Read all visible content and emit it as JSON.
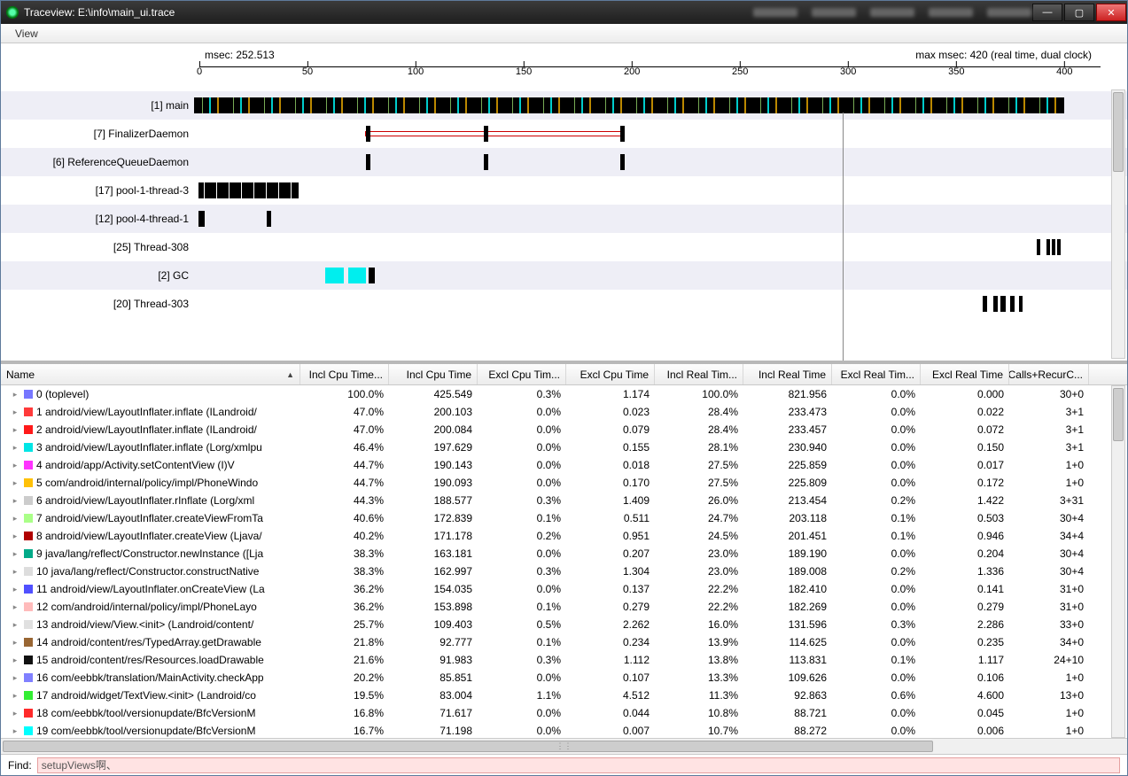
{
  "window": {
    "title": "Traceview: E:\\info\\main_ui.trace",
    "menu_view": "View"
  },
  "timeline": {
    "msec_label": "msec: 252.513",
    "max_label": "max msec: 420 (real time, dual clock)",
    "ticks": [
      "0",
      "50",
      "100",
      "150",
      "200",
      "250",
      "300",
      "350",
      "400"
    ],
    "cursor_pos_pct": 60.0,
    "rows": [
      {
        "label": "[1] main"
      },
      {
        "label": "[7] FinalizerDaemon"
      },
      {
        "label": "[6] ReferenceQueueDaemon"
      },
      {
        "label": "[17] pool-1-thread-3"
      },
      {
        "label": "[12] pool-4-thread-1"
      },
      {
        "label": "[25] Thread-308"
      },
      {
        "label": "[2] GC"
      },
      {
        "label": "[20] Thread-303"
      }
    ]
  },
  "table": {
    "headers": {
      "name": "Name",
      "c1": "Incl Cpu Time...",
      "c2": "Incl Cpu Time",
      "c3": "Excl Cpu Tim...",
      "c4": "Excl Cpu Time",
      "c5": "Incl Real Tim...",
      "c6": "Incl Real Time",
      "c7": "Excl Real Tim...",
      "c8": "Excl Real Time",
      "c9": "Calls+RecurC..."
    },
    "rows": [
      {
        "color": "#7777ff",
        "name": "0 (toplevel)",
        "c1": "100.0%",
        "c2": "425.549",
        "c3": "0.3%",
        "c4": "1.174",
        "c5": "100.0%",
        "c6": "821.956",
        "c7": "0.0%",
        "c8": "0.000",
        "c9": "30+0"
      },
      {
        "color": "#ff3a3a",
        "name": "1 android/view/LayoutInflater.inflate (ILandroid/",
        "c1": "47.0%",
        "c2": "200.103",
        "c3": "0.0%",
        "c4": "0.023",
        "c5": "28.4%",
        "c6": "233.473",
        "c7": "0.0%",
        "c8": "0.022",
        "c9": "3+1"
      },
      {
        "color": "#ff1a1a",
        "name": "2 android/view/LayoutInflater.inflate (ILandroid/",
        "c1": "47.0%",
        "c2": "200.084",
        "c3": "0.0%",
        "c4": "0.079",
        "c5": "28.4%",
        "c6": "233.457",
        "c7": "0.0%",
        "c8": "0.072",
        "c9": "3+1"
      },
      {
        "color": "#00e5e5",
        "name": "3 android/view/LayoutInflater.inflate (Lorg/xmlpu",
        "c1": "46.4%",
        "c2": "197.629",
        "c3": "0.0%",
        "c4": "0.155",
        "c5": "28.1%",
        "c6": "230.940",
        "c7": "0.0%",
        "c8": "0.150",
        "c9": "3+1"
      },
      {
        "color": "#ff33ff",
        "name": "4 android/app/Activity.setContentView (I)V",
        "c1": "44.7%",
        "c2": "190.143",
        "c3": "0.0%",
        "c4": "0.018",
        "c5": "27.5%",
        "c6": "225.859",
        "c7": "0.0%",
        "c8": "0.017",
        "c9": "1+0"
      },
      {
        "color": "#ffc107",
        "name": "5 com/android/internal/policy/impl/PhoneWindo",
        "c1": "44.7%",
        "c2": "190.093",
        "c3": "0.0%",
        "c4": "0.170",
        "c5": "27.5%",
        "c6": "225.809",
        "c7": "0.0%",
        "c8": "0.172",
        "c9": "1+0"
      },
      {
        "color": "#cccccc",
        "name": "6 android/view/LayoutInflater.rInflate (Lorg/xml",
        "c1": "44.3%",
        "c2": "188.577",
        "c3": "0.3%",
        "c4": "1.409",
        "c5": "26.0%",
        "c6": "213.454",
        "c7": "0.2%",
        "c8": "1.422",
        "c9": "3+31"
      },
      {
        "color": "#aaff88",
        "name": "7 android/view/LayoutInflater.createViewFromTa",
        "c1": "40.6%",
        "c2": "172.839",
        "c3": "0.1%",
        "c4": "0.511",
        "c5": "24.7%",
        "c6": "203.118",
        "c7": "0.1%",
        "c8": "0.503",
        "c9": "30+4"
      },
      {
        "color": "#b00000",
        "name": "8 android/view/LayoutInflater.createView (Ljava/",
        "c1": "40.2%",
        "c2": "171.178",
        "c3": "0.2%",
        "c4": "0.951",
        "c5": "24.5%",
        "c6": "201.451",
        "c7": "0.1%",
        "c8": "0.946",
        "c9": "34+4"
      },
      {
        "color": "#00aa88",
        "name": "9 java/lang/reflect/Constructor.newInstance ([Lja",
        "c1": "38.3%",
        "c2": "163.181",
        "c3": "0.0%",
        "c4": "0.207",
        "c5": "23.0%",
        "c6": "189.190",
        "c7": "0.0%",
        "c8": "0.204",
        "c9": "30+4"
      },
      {
        "color": "#dddddd",
        "name": "10 java/lang/reflect/Constructor.constructNative",
        "c1": "38.3%",
        "c2": "162.997",
        "c3": "0.3%",
        "c4": "1.304",
        "c5": "23.0%",
        "c6": "189.008",
        "c7": "0.2%",
        "c8": "1.336",
        "c9": "30+4"
      },
      {
        "color": "#5050ff",
        "name": "11 android/view/LayoutInflater.onCreateView (La",
        "c1": "36.2%",
        "c2": "154.035",
        "c3": "0.0%",
        "c4": "0.137",
        "c5": "22.2%",
        "c6": "182.410",
        "c7": "0.0%",
        "c8": "0.141",
        "c9": "31+0"
      },
      {
        "color": "#ffbbbb",
        "name": "12 com/android/internal/policy/impl/PhoneLayo",
        "c1": "36.2%",
        "c2": "153.898",
        "c3": "0.1%",
        "c4": "0.279",
        "c5": "22.2%",
        "c6": "182.269",
        "c7": "0.0%",
        "c8": "0.279",
        "c9": "31+0"
      },
      {
        "color": "#e0e0e0",
        "name": "13 android/view/View.<init> (Landroid/content/",
        "c1": "25.7%",
        "c2": "109.403",
        "c3": "0.5%",
        "c4": "2.262",
        "c5": "16.0%",
        "c6": "131.596",
        "c7": "0.3%",
        "c8": "2.286",
        "c9": "33+0"
      },
      {
        "color": "#996633",
        "name": "14 android/content/res/TypedArray.getDrawable",
        "c1": "21.8%",
        "c2": "92.777",
        "c3": "0.1%",
        "c4": "0.234",
        "c5": "13.9%",
        "c6": "114.625",
        "c7": "0.0%",
        "c8": "0.235",
        "c9": "34+0"
      },
      {
        "color": "#111111",
        "name": "15 android/content/res/Resources.loadDrawable",
        "c1": "21.6%",
        "c2": "91.983",
        "c3": "0.3%",
        "c4": "1.112",
        "c5": "13.8%",
        "c6": "113.831",
        "c7": "0.1%",
        "c8": "1.117",
        "c9": "24+10"
      },
      {
        "color": "#8080ff",
        "name": "16 com/eebbk/translation/MainActivity.checkApp",
        "c1": "20.2%",
        "c2": "85.851",
        "c3": "0.0%",
        "c4": "0.107",
        "c5": "13.3%",
        "c6": "109.626",
        "c7": "0.0%",
        "c8": "0.106",
        "c9": "1+0"
      },
      {
        "color": "#33ee33",
        "name": "17 android/widget/TextView.<init> (Landroid/co",
        "c1": "19.5%",
        "c2": "83.004",
        "c3": "1.1%",
        "c4": "4.512",
        "c5": "11.3%",
        "c6": "92.863",
        "c7": "0.6%",
        "c8": "4.600",
        "c9": "13+0"
      },
      {
        "color": "#ff2a2a",
        "name": "18 com/eebbk/tool/versionupdate/BfcVersionM",
        "c1": "16.8%",
        "c2": "71.617",
        "c3": "0.0%",
        "c4": "0.044",
        "c5": "10.8%",
        "c6": "88.721",
        "c7": "0.0%",
        "c8": "0.045",
        "c9": "1+0"
      },
      {
        "color": "#00ffff",
        "name": "19 com/eebbk/tool/versionupdate/BfcVersionM",
        "c1": "16.7%",
        "c2": "71.198",
        "c3": "0.0%",
        "c4": "0.007",
        "c5": "10.7%",
        "c6": "88.272",
        "c7": "0.0%",
        "c8": "0.006",
        "c9": "1+0"
      }
    ]
  },
  "find": {
    "label": "Find:",
    "value": "setupViews啊、"
  },
  "chart_data": {
    "type": "table",
    "title": "Method profiling (Traceview)",
    "columns": [
      "Name",
      "Incl Cpu Time %",
      "Incl Cpu Time",
      "Excl Cpu Time %",
      "Excl Cpu Time",
      "Incl Real Time %",
      "Incl Real Time",
      "Excl Real Time %",
      "Excl Real Time",
      "Calls+RecurCalls"
    ],
    "rows_ref": "table.rows",
    "timeline_range_ms": [
      0,
      420
    ],
    "timeline_cursor_ms": 252.513
  }
}
